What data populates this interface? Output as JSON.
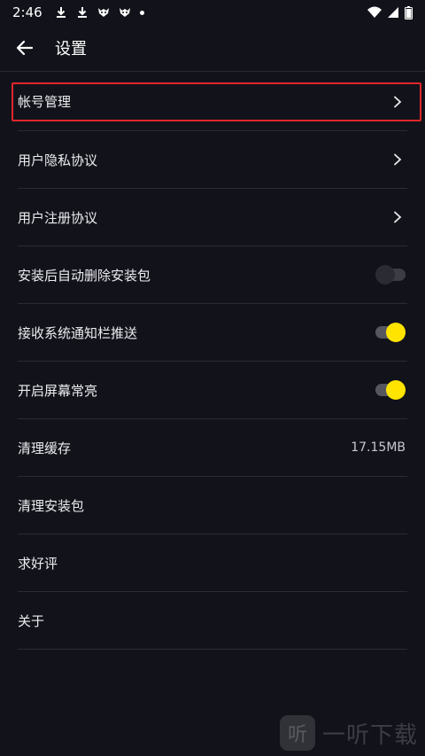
{
  "status_bar": {
    "time": "2:46",
    "left_icons": [
      "download-icon",
      "download-icon",
      "app-notification-icon",
      "app-notification-icon",
      "dot-icon"
    ],
    "right_icons": [
      "wifi-icon",
      "signal-icon",
      "battery-icon"
    ]
  },
  "header": {
    "back_icon": "arrow-left-icon",
    "title": "设置"
  },
  "settings": {
    "account": {
      "label": "帐号管理"
    },
    "privacy": {
      "label": "用户隐私协议"
    },
    "register": {
      "label": "用户注册协议"
    },
    "auto_delete": {
      "label": "安装后自动删除安装包",
      "enabled": false
    },
    "notify": {
      "label": "接收系统通知栏推送",
      "enabled": true
    },
    "screen_on": {
      "label": "开启屏幕常亮",
      "enabled": true
    },
    "clear_cache": {
      "label": "清理缓存",
      "value": "17.15MB"
    },
    "clear_packages": {
      "label": "清理安装包"
    },
    "rate": {
      "label": "求好评"
    },
    "about": {
      "label": "关于"
    }
  },
  "watermark": {
    "text": "一听下载",
    "logo_glyph": "听"
  },
  "colors": {
    "background": "#12131a",
    "accent": "#ffe400",
    "highlight": "#e0262b",
    "divider": "#2a2b33"
  }
}
